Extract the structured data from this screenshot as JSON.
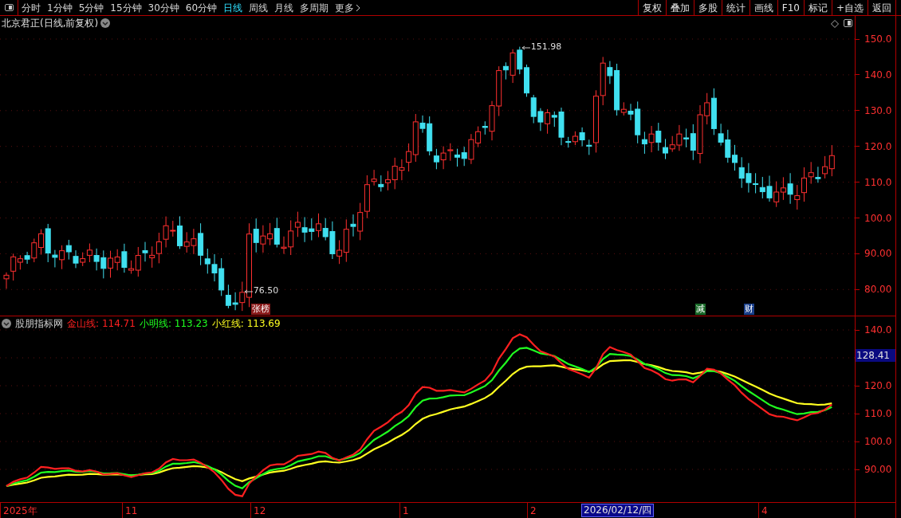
{
  "toolbar": {
    "periods": [
      {
        "label": "分时",
        "selected": false
      },
      {
        "label": "1分钟",
        "selected": false
      },
      {
        "label": "5分钟",
        "selected": false
      },
      {
        "label": "15分钟",
        "selected": false
      },
      {
        "label": "30分钟",
        "selected": false
      },
      {
        "label": "60分钟",
        "selected": false
      },
      {
        "label": "日线",
        "selected": true
      },
      {
        "label": "周线",
        "selected": false
      },
      {
        "label": "月线",
        "selected": false
      },
      {
        "label": "多周期",
        "selected": false
      }
    ],
    "more": "更多",
    "actions": [
      "复权",
      "叠加",
      "多股",
      "统计",
      "画线",
      "F10",
      "标记",
      "+自选",
      "返回"
    ]
  },
  "price_panel": {
    "title": "北京君正(日线,前复权)",
    "axis_labels": [
      "150.0",
      "140.0",
      "130.0",
      "120.0",
      "110.0",
      "100.0",
      "90.00",
      "80.00"
    ],
    "high_mark": "151.98",
    "low_mark": "76.50",
    "events": [
      {
        "label": "张榜",
        "color": "#8b1a1a"
      },
      {
        "label": "减",
        "color": "#1a6b2a"
      },
      {
        "label": "财",
        "color": "#1a3f8b"
      }
    ]
  },
  "indicator_panel": {
    "name": "股朋指标网",
    "series": [
      {
        "label": "金山线:",
        "value": "114.71",
        "color": "#ff2020"
      },
      {
        "label": "小明线:",
        "value": "113.23",
        "color": "#20ff20"
      },
      {
        "label": "小红线:",
        "value": "113.69",
        "color": "#ffff20"
      }
    ],
    "axis_labels": [
      "140.0",
      "120.0",
      "110.0",
      "100.0",
      "90.00"
    ],
    "cursor_value": "128.41"
  },
  "time_axis": {
    "labels": [
      "2025年",
      "11",
      "12",
      "1",
      "2",
      "4"
    ],
    "cursor_label": "2026/02/12/四"
  }
}
